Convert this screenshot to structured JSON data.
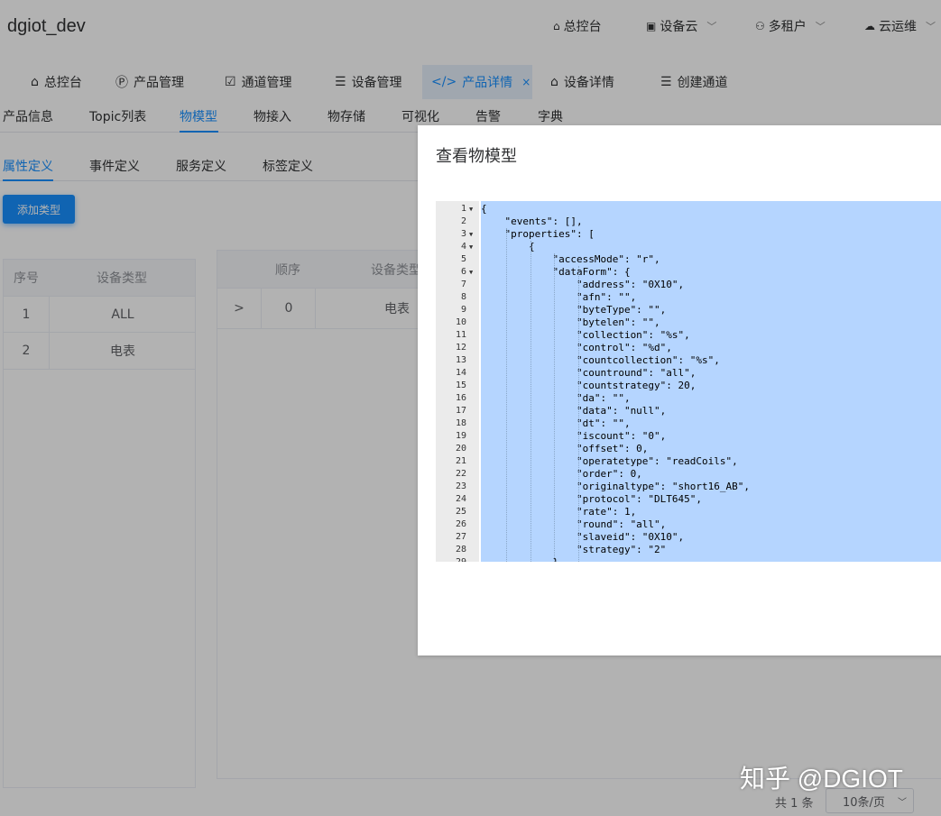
{
  "app": {
    "title": "dgiot_dev"
  },
  "header": {
    "items": [
      {
        "icon": "home-icon",
        "label": "总控台"
      },
      {
        "icon": "device-cloud-icon",
        "label": "设备云"
      },
      {
        "icon": "users-icon",
        "label": "多租户"
      },
      {
        "icon": "cloud-icon",
        "label": "云运维"
      }
    ]
  },
  "tags": [
    {
      "icon": "home-icon",
      "label": "总控台"
    },
    {
      "icon": "product-icon",
      "label": "产品管理"
    },
    {
      "icon": "channel-icon",
      "label": "通道管理"
    },
    {
      "icon": "list-icon",
      "label": "设备管理"
    },
    {
      "icon": "code-icon",
      "label": "产品详情",
      "close": "×"
    },
    {
      "icon": "home-icon",
      "label": "设备详情"
    },
    {
      "icon": "list-icon",
      "label": "创建通道"
    }
  ],
  "subtabs": [
    "产品信息",
    "Topic列表",
    "物模型",
    "物接入",
    "物存储",
    "可视化",
    "告警",
    "字典"
  ],
  "defTabs": [
    "属性定义",
    "事件定义",
    "服务定义",
    "标签定义"
  ],
  "addButton": "添加类型",
  "leftTable": {
    "headers": [
      "序号",
      "设备类型"
    ],
    "rows": [
      [
        "1",
        "ALL"
      ],
      [
        "2",
        "电表"
      ]
    ]
  },
  "rightTable": {
    "headers": [
      "顺序",
      "设备类型"
    ],
    "rows": [
      [
        ">",
        "0",
        "电表"
      ]
    ]
  },
  "dialog": {
    "title": "查看物模型",
    "lines": [
      "{",
      "    \"events\": [],",
      "    \"properties\": [",
      "        {",
      "            \"accessMode\": \"r\",",
      "            \"dataForm\": {",
      "                \"address\": \"0X10\",",
      "                \"afn\": \"\",",
      "                \"byteType\": \"\",",
      "                \"bytelen\": \"\",",
      "                \"collection\": \"%s\",",
      "                \"control\": \"%d\",",
      "                \"countcollection\": \"%s\",",
      "                \"countround\": \"all\",",
      "                \"countstrategy\": 20,",
      "                \"da\": \"\",",
      "                \"data\": \"null\",",
      "                \"dt\": \"\",",
      "                \"iscount\": \"0\",",
      "                \"offset\": 0,",
      "                \"operatetype\": \"readCoils\",",
      "                \"order\": 0,",
      "                \"originaltype\": \"short16_AB\",",
      "                \"protocol\": \"DLT645\",",
      "                \"rate\": 1,",
      "                \"round\": \"all\",",
      "                \"slaveid\": \"0X10\",",
      "                \"strategy\": \"2\"",
      "            }"
    ],
    "foldLines": [
      1,
      3,
      4,
      6
    ]
  },
  "pagination": {
    "total": "共 1 条",
    "pageSize": "10条/页"
  },
  "watermark": "知乎 @DGIOT",
  "colors": {
    "accent": "#1890ff",
    "selection": "#b5d5ff"
  }
}
